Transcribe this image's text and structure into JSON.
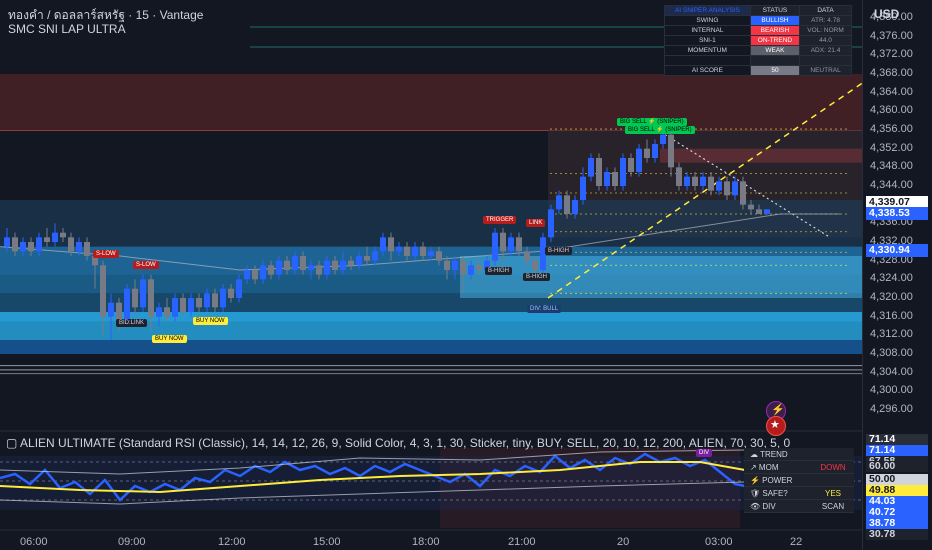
{
  "header": {
    "symbol_line": "ทองคำ / ดอลลาร์สหรัฐ · 15 · Vantage",
    "indicator_line": "SMC SNI LAP  ULTRA"
  },
  "currency": "USD",
  "price_axis": {
    "labels": [
      "4,380.00",
      "4,376.00",
      "4,372.00",
      "4,368.00",
      "4,364.00",
      "4,360.00",
      "4,356.00",
      "4,352.00",
      "4,348.00",
      "4,344.00",
      "4,340.00",
      "4,336.00",
      "4,332.00",
      "4,328.00",
      "4,324.00",
      "4,320.00",
      "4,316.00",
      "4,312.00",
      "4,308.00",
      "4,304.00",
      "4,300.00",
      "4,296.00"
    ],
    "badges": [
      {
        "text": "4,339.07",
        "bg": "#ffffff",
        "fg": "#131722"
      },
      {
        "text": "4,338.53",
        "bg": "#2962ff",
        "fg": "#ffffff"
      },
      {
        "text": "4,330.94",
        "bg": "#2962ff",
        "fg": "#ffffff"
      }
    ]
  },
  "rsi_axis": {
    "badges": [
      {
        "text": "71.14",
        "bg": "#2a2e39",
        "fg": "#ffffff"
      },
      {
        "text": "71.14",
        "bg": "#2962ff",
        "fg": "#ffffff"
      },
      {
        "text": "67.58",
        "bg": "#1e222d",
        "fg": "#d1d4dc"
      },
      {
        "text": "60.00",
        "bg": "#1e222d",
        "fg": "#d1d4dc"
      },
      {
        "text": "50.00",
        "bg": "#d1d4dc",
        "fg": "#131722"
      },
      {
        "text": "49.88",
        "bg": "#ffeb3b",
        "fg": "#131722"
      },
      {
        "text": "44.03",
        "bg": "#2962ff",
        "fg": "#ffffff"
      },
      {
        "text": "40.72",
        "bg": "#2962ff",
        "fg": "#ffffff"
      },
      {
        "text": "38.78",
        "bg": "#2962ff",
        "fg": "#ffffff"
      },
      {
        "text": "30.78",
        "bg": "#1e222d",
        "fg": "#d1d4dc"
      }
    ]
  },
  "time_axis": [
    "06:00",
    "09:00",
    "12:00",
    "15:00",
    "18:00",
    "21:00",
    "20",
    "03:00",
    "22"
  ],
  "indicator_title": "▢ ALIEN ULTIMATE (Standard RSI (Classic), 14, 14, 12, 26, 9, Solid Color, 4, 3, 1, 30, Sticker, tiny, BUY, SELL, 20, 10, 12, 200, ALIEN, 70, 30, 5, 0",
  "ai_table": {
    "headers": [
      "AI SNIPER ANALYSIS",
      "STATUS",
      "DATA"
    ],
    "rows": [
      {
        "label": "SWING",
        "status": "BULLISH",
        "status_bg": "#2962ff",
        "data": "ATR: 4.78"
      },
      {
        "label": "INTERNAL",
        "status": "BEARISH",
        "status_bg": "#f23645",
        "data": "VOL: NORM"
      },
      {
        "label": "SNI-1",
        "status": "ON-TREND",
        "status_bg": "#f23645",
        "data": "44.0"
      },
      {
        "label": "MOMENTUM",
        "status": "WEAK",
        "status_bg": "#5d606b",
        "data": "ADX: 21.4"
      },
      {
        "label": "",
        "status": "",
        "status_bg": "#1e222d",
        "data": ""
      },
      {
        "label": "AI SCORE",
        "status": "50",
        "status_bg": "#787b86",
        "data": "NEUTRAL"
      }
    ]
  },
  "side_panel": {
    "rows": [
      {
        "icon": "☁",
        "label": "TREND",
        "value": "",
        "value_color": "#d1d4dc"
      },
      {
        "icon": "↗",
        "label": "MOM",
        "value": "DOWN",
        "value_color": "#f23645"
      },
      {
        "icon": "⚡",
        "label": "POWER",
        "value": "",
        "value_color": "#d1d4dc"
      },
      {
        "icon": "🛡",
        "label": "SAFE?",
        "value": "YES",
        "value_color": "#ffeb3b"
      },
      {
        "icon": "👁",
        "label": "DIV",
        "value": "SCAN",
        "value_color": "#d1d4dc"
      }
    ]
  },
  "price_tags": {
    "big_sell_1": "BIG SELL ⚡ (SNIPER)",
    "big_sell_2": "BIG SELL ⚡ (SNIPER)",
    "s_low_1": "S-LOW",
    "s_low_2": "S-LOW",
    "buy_now_1": "BUY NOW",
    "buy_now_2": "BUY NOW",
    "b_high_1": "B-HIGH",
    "b_high_2": "B-HIGH",
    "b_high_3": "B-HIGH",
    "div_bull": "DIV: BULL",
    "bid_link": "BID:LINK",
    "trigger": "TRIGGER",
    "link": "LINK",
    "div_rsi": "DIV"
  },
  "colors": {
    "bull": "#2962ff",
    "bear": "#787b86",
    "zone_red": "#5c2a30",
    "zone_blue": "#2196f3",
    "zone_cyan": "#00bcd4",
    "rsi_line": "#2962ff",
    "signal_line": "#ffeb3b",
    "dashed_yellow": "#ffeb3b"
  }
}
